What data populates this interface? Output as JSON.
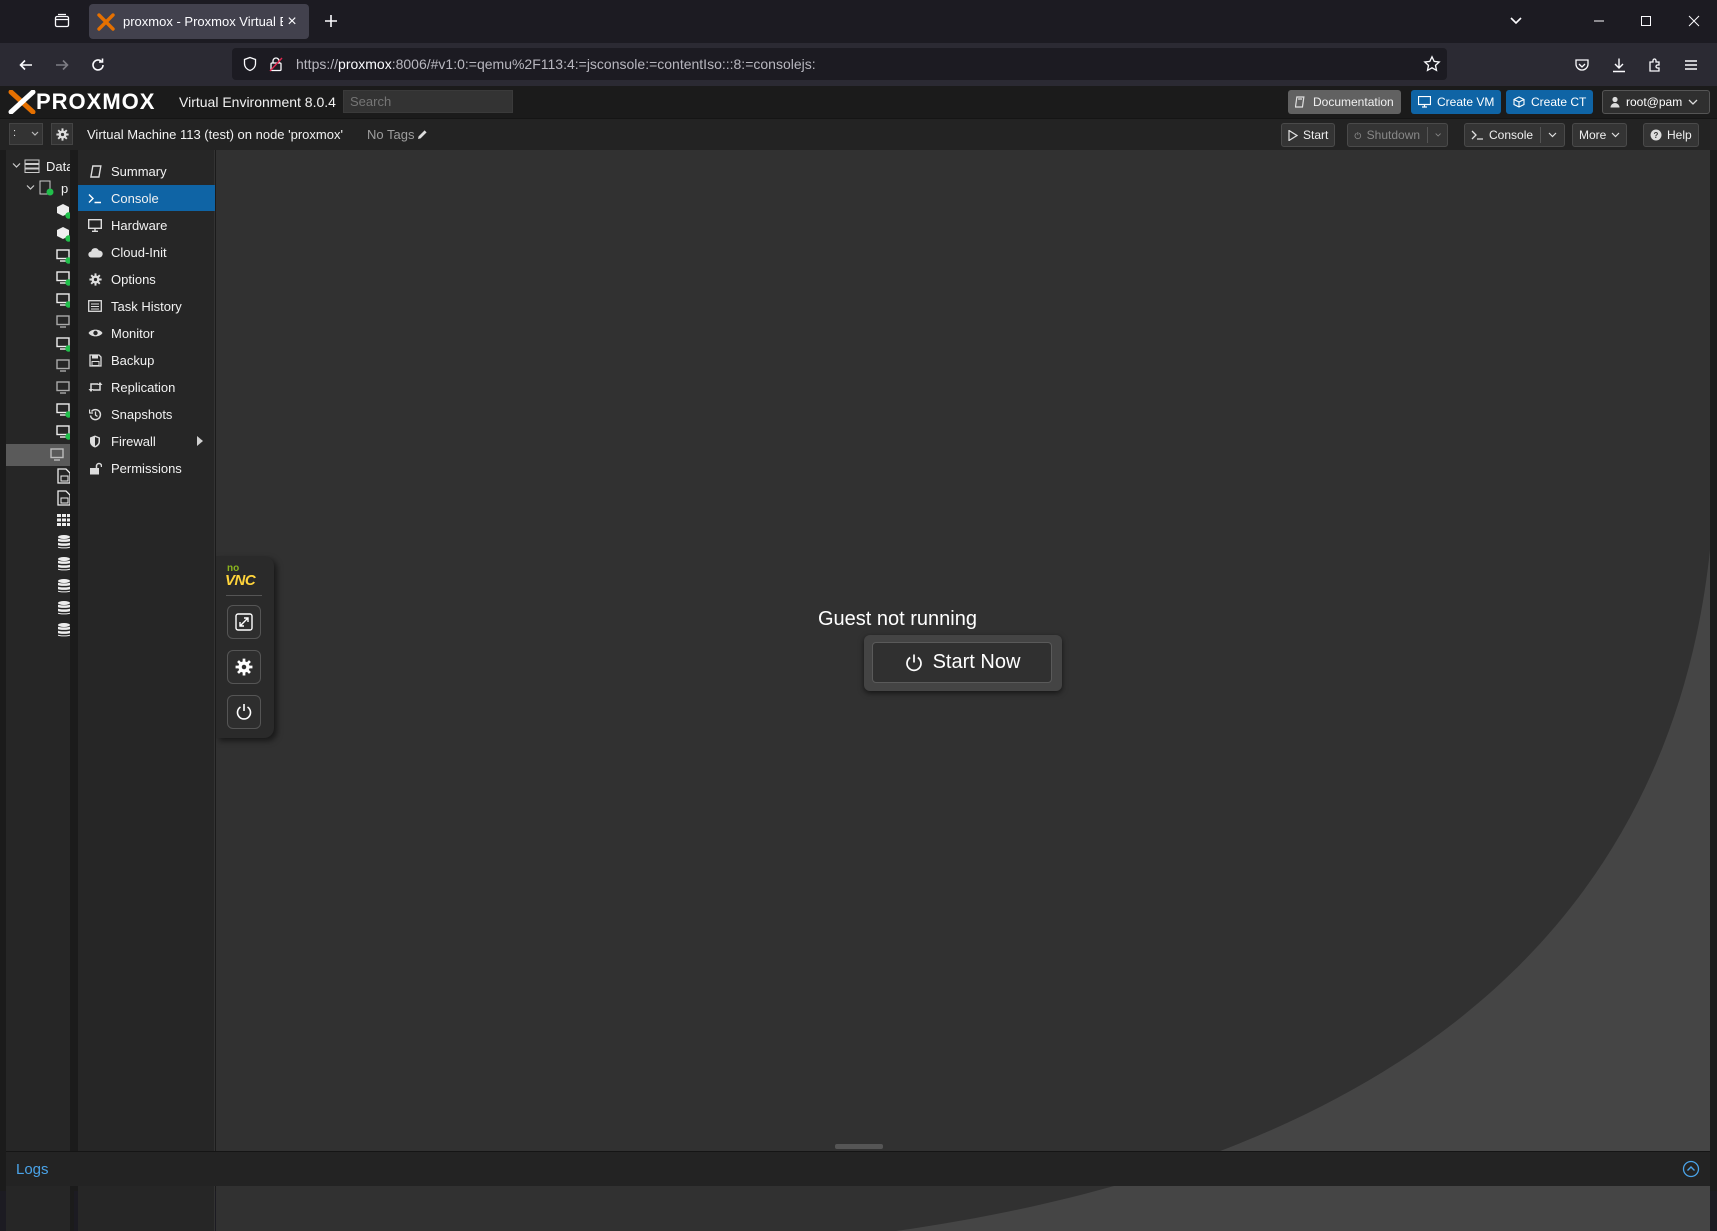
{
  "browser": {
    "tab_title": "proxmox - Proxmox Virtual Environment",
    "url_host": "proxmox",
    "url_rest": ":8006/#v1:0:=qemu%2F113:4:=jsconsole:=contentIso:::8:=consolejs:",
    "url_scheme": "https://",
    "accent": "#e57000"
  },
  "pve": {
    "logo_text": "PROXMOX",
    "version": "Virtual Environment 8.0.4",
    "search_placeholder": "Search",
    "header_buttons": {
      "documentation": "Documentation",
      "create_vm": "Create VM",
      "create_ct": "Create CT",
      "user": "root@pam"
    },
    "toolbar": {
      "tree_view_value": ":",
      "vm_title": "Virtual Machine 113 (test) on node 'proxmox'",
      "no_tags": "No Tags",
      "start": "Start",
      "shutdown": "Shutdown",
      "console": "Console",
      "more": "More",
      "help": "Help"
    },
    "tree": {
      "root_label": "Data",
      "node_label": "p"
    },
    "nav": [
      {
        "label": "Summary",
        "icon": "book-icon"
      },
      {
        "label": "Console",
        "icon": "terminal-icon"
      },
      {
        "label": "Hardware",
        "icon": "desktop-icon"
      },
      {
        "label": "Cloud-Init",
        "icon": "cloud-icon"
      },
      {
        "label": "Options",
        "icon": "gear-icon"
      },
      {
        "label": "Task History",
        "icon": "list-icon"
      },
      {
        "label": "Monitor",
        "icon": "eye-icon"
      },
      {
        "label": "Backup",
        "icon": "floppy-icon"
      },
      {
        "label": "Replication",
        "icon": "retweet-icon"
      },
      {
        "label": "Snapshots",
        "icon": "history-icon"
      },
      {
        "label": "Firewall",
        "icon": "shield-icon"
      },
      {
        "label": "Permissions",
        "icon": "unlock-icon"
      }
    ],
    "active_nav": "Console",
    "console": {
      "novnc_logo": "VNC",
      "novnc_logo_small": "no",
      "status": "Guest not running",
      "start_button": "Start Now"
    },
    "logs_label": "Logs",
    "colors": {
      "active_blue": "#0f64a5",
      "link_blue": "#4aa3e8",
      "status_green": "#21bf4b"
    }
  }
}
